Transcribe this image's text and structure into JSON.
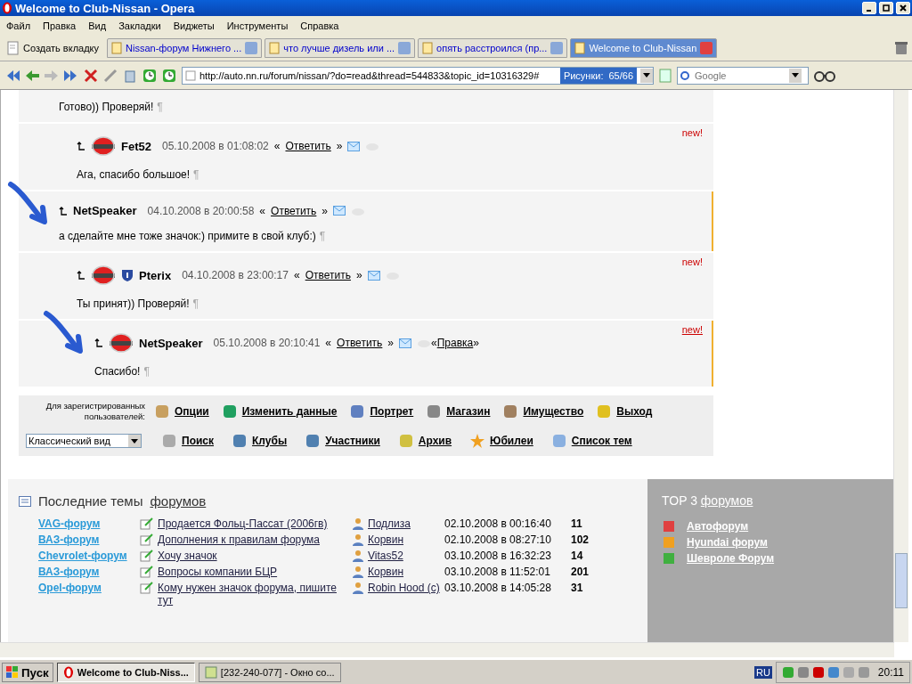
{
  "window": {
    "title": "Welcome to Club-Nissan - Opera"
  },
  "menu": [
    "Файл",
    "Правка",
    "Вид",
    "Закладки",
    "Виджеты",
    "Инструменты",
    "Справка"
  ],
  "tabs": [
    {
      "label": "Создать вкладку",
      "kind": "new",
      "selected": false
    },
    {
      "label": "Nissan-форум Нижнего ...",
      "kind": "page",
      "selected": false
    },
    {
      "label": "что лучше дизель или ...",
      "kind": "page",
      "selected": false
    },
    {
      "label": "опять расстроился (пр...",
      "kind": "page",
      "selected": false
    },
    {
      "label": "Welcome to Club-Nissan",
      "kind": "page",
      "selected": true
    }
  ],
  "address": {
    "value": "http://auto.nn.ru/forum/nissan/?do=read&thread=544833&topic_id=10316329#",
    "images_label": "Рисунки:",
    "images_count": "65/66"
  },
  "search": {
    "placeholder": "Google"
  },
  "posts": [
    {
      "text": "Готово)) Проверяй!",
      "pilcrow": "¶",
      "highlighted": false,
      "children": [
        {
          "author": "Fet52",
          "avatar": true,
          "badge": false,
          "date": "05.10.2008 в 01:08:02",
          "quote_open": "«",
          "reply": "Ответить",
          "quote_close": "»",
          "text": "Ага, спасибо большое!",
          "pilcrow": "¶",
          "new": "new!",
          "new_link": false,
          "highlighted": false
        }
      ]
    },
    {
      "author": "NetSpeaker",
      "avatar": false,
      "badge": false,
      "date": "04.10.2008 в 20:00:58",
      "quote_open": "«",
      "reply": "Ответить",
      "quote_close": "»",
      "text": "а сделайте мне тоже значок:) примите в свой клуб:)",
      "pilcrow": "¶",
      "highlighted": true,
      "arrow": true,
      "children": [
        {
          "author": "Pterix",
          "avatar": true,
          "badge": true,
          "date": "04.10.2008 в 23:00:17",
          "quote_open": "«",
          "reply": "Ответить",
          "quote_close": "»",
          "text": "Ты принят)) Проверяй!",
          "pilcrow": "¶",
          "new": "new!",
          "new_link": false,
          "highlighted": false,
          "children": [
            {
              "author": "NetSpeaker",
              "avatar": true,
              "badge": false,
              "date": "05.10.2008 в 20:10:41",
              "quote_open": "«",
              "reply": "Ответить",
              "quote_close": "»",
              "edit_open": "«",
              "edit": "Правка",
              "edit_close": "»",
              "text": "Спасибо!",
              "pilcrow": "¶",
              "new": "new!",
              "new_link": true,
              "highlighted": true,
              "arrow": true
            }
          ]
        }
      ]
    }
  ],
  "nav": {
    "registered_label": "Для зарегистрированных пользователей:",
    "user_links": [
      "Опции",
      "Изменить данные",
      "Портрет",
      "Магазин",
      "Имущество",
      "Выход"
    ],
    "view_select": "Классический вид",
    "links": [
      "Поиск",
      "Клубы",
      "Участники",
      "Архив",
      "Юбилеи",
      "Список тем"
    ]
  },
  "latest": {
    "title": "Последние темы",
    "title_link": "форумов",
    "rows": [
      {
        "forum": "VAG-форум",
        "topic": "Продается Фольц-Пассат (2006гв)",
        "author": "Подлиза",
        "date": "02.10.2008 в 00:16:40",
        "count": "11"
      },
      {
        "forum": "ВАЗ-форум",
        "topic": "Дополнения к правилам форума",
        "author": "Корвин",
        "date": "02.10.2008 в 08:27:10",
        "count": "102"
      },
      {
        "forum": "Chevrolet-форум",
        "topic": "Хочу значок",
        "author": "Vitas52",
        "date": "03.10.2008 в 16:32:23",
        "count": "14"
      },
      {
        "forum": "ВАЗ-форум",
        "topic": "Вопросы компании БЦР",
        "author": "Корвин",
        "date": "03.10.2008 в 11:52:01",
        "count": "201"
      },
      {
        "forum": "Opel-форум",
        "topic": "Кому нужен значок форума, пишите тут",
        "author": "Robin Hood (c)",
        "date": "03.10.2008 в 14:05:28",
        "count": "31"
      }
    ]
  },
  "top3": {
    "title": "TOP 3",
    "title_link": "форумов",
    "items": [
      {
        "label": "Автофорум",
        "color": "#e04040"
      },
      {
        "label": "Hyundai форум",
        "color": "#f0a020"
      },
      {
        "label": "Шевроле Форум",
        "color": "#40b040"
      }
    ]
  },
  "taskbar": {
    "start": "Пуск",
    "tasks": [
      {
        "label": "Welcome to Club-Niss...",
        "kind": "browser",
        "selected": true
      },
      {
        "label": "[232-240-077] - Окно со...",
        "kind": "chat",
        "selected": false
      }
    ],
    "language": "RU",
    "clock": "20:11"
  }
}
